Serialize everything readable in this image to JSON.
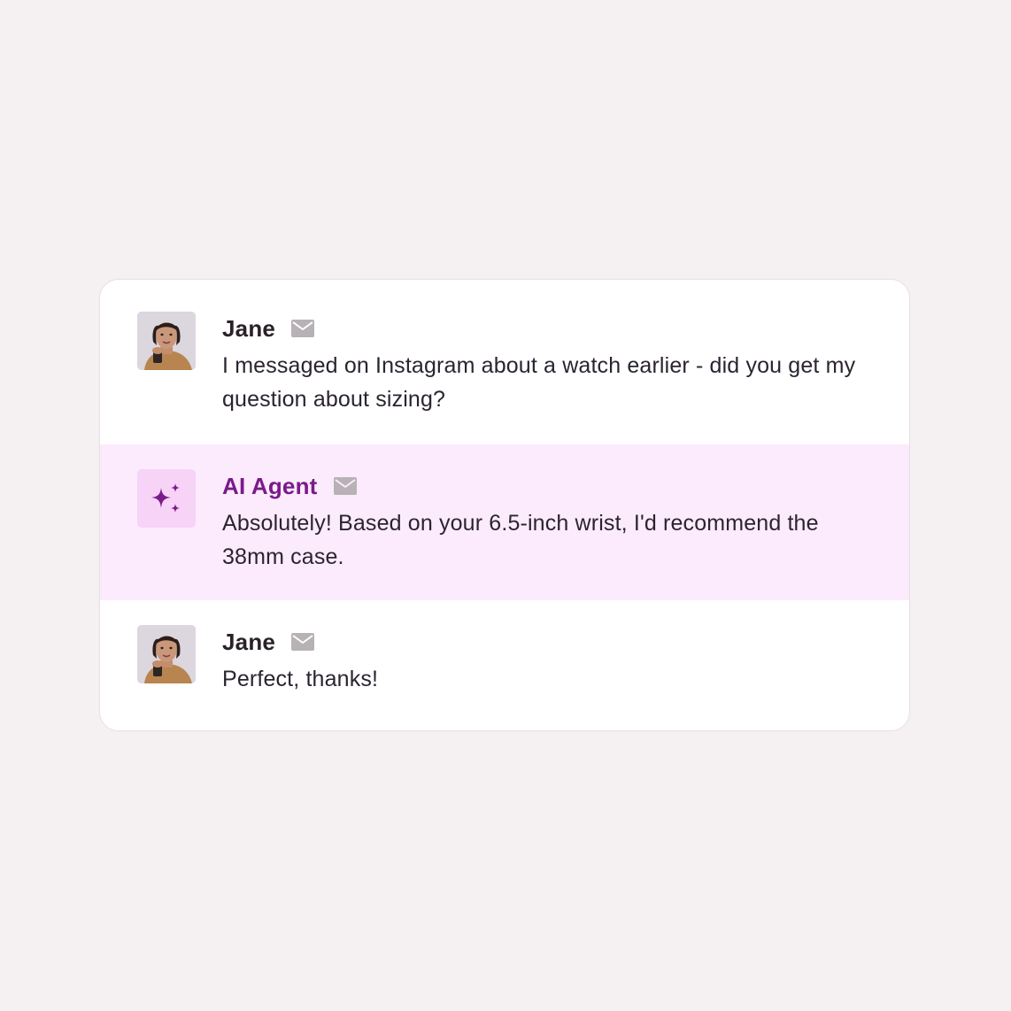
{
  "messages": [
    {
      "sender": "Jane",
      "avatar_icon": "user-photo-icon",
      "channel_icon": "mail-icon",
      "text": "I messaged on Instagram about a watch earlier - did you get my question about sizing?"
    },
    {
      "sender": "AI Agent",
      "avatar_icon": "sparkles-icon",
      "channel_icon": "mail-icon",
      "text": "Absolutely! Based on your 6.5-inch wrist, I'd recommend the 38mm case."
    },
    {
      "sender": "Jane",
      "avatar_icon": "user-photo-icon",
      "channel_icon": "mail-icon",
      "text": "Perfect, thanks!"
    }
  ],
  "colors": {
    "page_background": "#f5f0f1",
    "card_background": "#ffffff",
    "ai_row_background": "#fcebfc",
    "ai_accent": "#7a1b8a",
    "ai_avatar_background": "#f7d3f7",
    "mail_icon": "#b7b2b5"
  }
}
